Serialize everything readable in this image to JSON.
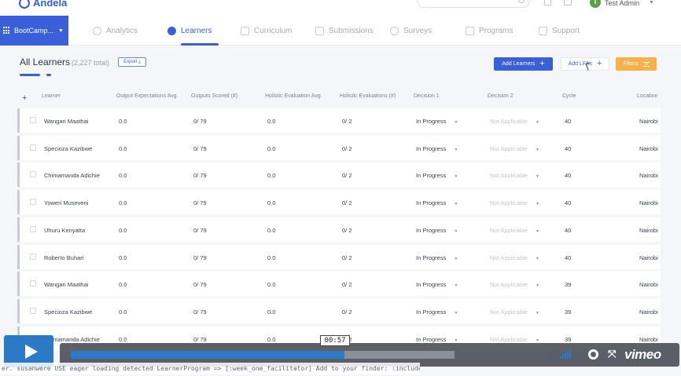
{
  "brand": {
    "name": "Andela"
  },
  "user": {
    "initial": "T",
    "name": "Test Admin"
  },
  "bootcamp": {
    "label": "BootCamp..."
  },
  "tabs": [
    {
      "label": "Analytics"
    },
    {
      "label": "Learners"
    },
    {
      "label": "Curriculum"
    },
    {
      "label": "Submissions"
    },
    {
      "label": "Surveys"
    },
    {
      "label": "Programs"
    },
    {
      "label": "Support"
    }
  ],
  "header": {
    "title": "All Learners",
    "count": "(2,227 total)",
    "export_label": "Export",
    "add_learners_label": "Add Learners",
    "add_lfas_label": "Add LFAs",
    "filters_label": "Filters"
  },
  "table": {
    "add_column": "+",
    "columns": [
      "Learner",
      "Output Expectations Avg.",
      "Outputs Scored (#)",
      "Holistic Evaluation Avg.",
      "Holistic Evaluations (#)",
      "Decision 1",
      "Decision 2",
      "Cycle",
      "Location"
    ],
    "rows": [
      {
        "learner": "Wangari Maathai",
        "oe_avg": "0.0",
        "outputs": "0/ 79",
        "he_avg": "0.0",
        "he_count": "0/ 2",
        "d1": "In Progress",
        "d2": "Not Applicable",
        "cycle": "40",
        "location": "Nairobi"
      },
      {
        "learner": "Specioza Kazibwe",
        "oe_avg": "0.0",
        "outputs": "0/ 79",
        "he_avg": "0.0",
        "he_count": "0/ 2",
        "d1": "In Progress",
        "d2": "Not Applicable",
        "cycle": "40",
        "location": "Nairobi"
      },
      {
        "learner": "Chimamanda Adichie",
        "oe_avg": "0.0",
        "outputs": "0/ 79",
        "he_avg": "0.0",
        "he_count": "0/ 2",
        "d1": "In Progress",
        "d2": "Not Applicable",
        "cycle": "40",
        "location": "Nairobi"
      },
      {
        "learner": "Yoweri Museveni",
        "oe_avg": "0.0",
        "outputs": "0/ 79",
        "he_avg": "0.0",
        "he_count": "0/ 2",
        "d1": "In Progress",
        "d2": "Not Applicable",
        "cycle": "40",
        "location": "Nairobi"
      },
      {
        "learner": "Uhuru Kenyatta",
        "oe_avg": "0.0",
        "outputs": "0/ 79",
        "he_avg": "0.0",
        "he_count": "0/ 2",
        "d1": "In Progress",
        "d2": "Not Applicable",
        "cycle": "40",
        "location": "Nairobi"
      },
      {
        "learner": "Roberto Buhari",
        "oe_avg": "0.0",
        "outputs": "0/ 79",
        "he_avg": "0.0",
        "he_count": "0/ 2",
        "d1": "In Progress",
        "d2": "Not Applicable",
        "cycle": "40",
        "location": "Nairobi"
      },
      {
        "learner": "Wangari Maathai",
        "oe_avg": "0.0",
        "outputs": "0/ 79",
        "he_avg": "0.0",
        "he_count": "0/ 2",
        "d1": "In Progress",
        "d2": "Not Applicable",
        "cycle": "39",
        "location": "Nairobi"
      },
      {
        "learner": "Specioza Kazibwe",
        "oe_avg": "0.0",
        "outputs": "0/ 79",
        "he_avg": "0.0",
        "he_count": "0/ 2",
        "d1": "In Progress",
        "d2": "Not Applicable",
        "cycle": "39",
        "location": "Nairobi"
      },
      {
        "learner": "Chimamanda Adichie",
        "oe_avg": "0.0",
        "outputs": "0/ 79",
        "he_avg": "0.0",
        "he_count": "0/ 2",
        "d1": "In Progress",
        "d2": "Not Applicable",
        "cycle": "39",
        "location": "Nairobi"
      }
    ]
  },
  "player": {
    "time": "00:57",
    "progress_percent": 57,
    "loaded_percent": 80,
    "brand": "vimeo",
    "accent": "#2b79c7"
  },
  "console": {
    "text": "er. susanwere USE eager loading detected LearnerProgram => [:week_one_facilitator] Add to your finder: :includes => [:week_one_facilitator]"
  }
}
